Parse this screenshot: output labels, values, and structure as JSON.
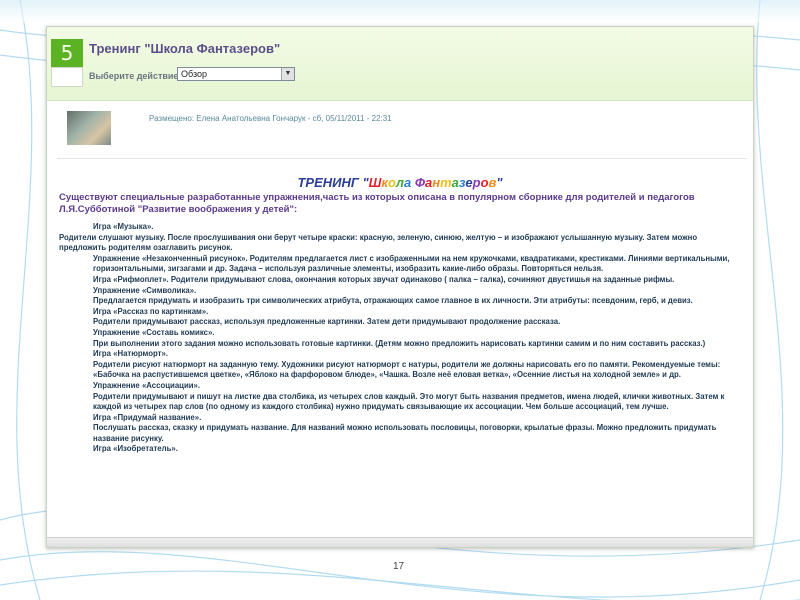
{
  "panel": {
    "badge": "5",
    "title": "Тренинг \"Школа Фантазеров\"",
    "action_label": "Выберите действие:",
    "action_value": "Обзор",
    "posted": "Размещено: Елена Анатольевна Гончарук - сб, 05/11/2011 - 22:31"
  },
  "doc": {
    "title_prefix": "ТРЕНИНГ  \"",
    "title_letters": [
      "Ш",
      "к",
      "о",
      "л",
      "а",
      " ",
      "Ф",
      "а",
      "н",
      "т",
      "а",
      "з",
      "е",
      "р",
      "о",
      "в"
    ],
    "title_suffix": "\"",
    "intro": "Существуют специальные разработанные упражнения,часть из которых описана в популярном сборнике для родителей и педагогов Л.Я.Субботиной \"Развитие воображения у детей\":",
    "lines": [
      {
        "t": "Игра «Музыка».",
        "ind": true
      },
      {
        "t": "Родители слушают музыку. После прослушивания они берут четыре краски: красную, зеленую, синюю, желтую – и изображают услышанную музыку. Затем можно предложить родителям озаглавить рисунок.",
        "ind": false
      },
      {
        "t": "Упражнение «Незаконченный рисунок». Родителям предлагается лист с изображенными на нем кружочками, квадратиками, крестиками. Линиями вертикальными, горизонтальными, зигзагами и др. Задача – используя различные элементы, изобразить какие-либо образы. Повторяться нельзя.",
        "ind": true
      },
      {
        "t": "Игра «Рифмоплет». Родители придумывают слова, окончания которых звучат одинаково ( палка – галка), сочиняют двустишья на  заданные рифмы.",
        "ind": true
      },
      {
        "t": "Упражнение «Символика».",
        "ind": true
      },
      {
        "t": "Предлагается  придумать и изобразить три символических атрибута, отражающих самое главное в их личности. Эти атрибуты: псевдоним, герб, и девиз.",
        "ind": true
      },
      {
        "t": "Игра «Рассказ по картинкам».",
        "ind": true
      },
      {
        "t": "Родители придумывают рассказ, используя предложенные картинки. Затем дети придумывают продолжение рассказа.",
        "ind": true
      },
      {
        "t": "Упражнение «Составь комикс».",
        "ind": true
      },
      {
        "t": "При выполнении этого задания можно использовать готовые  картинки. (Детям можно предложить нарисовать картинки   самим и по ним составить рассказ.)",
        "ind": true
      },
      {
        "t": "Игра «Натюрморт».",
        "ind": true
      },
      {
        "t": "Родители рисуют натюрморт на заданную тему. Художники рисуют натюрморт с натуры, родители же должны нарисовать его по памяти. Рекомендуемые  темы: «Бабочка на распустившемся цветке», «Яблоко на фарфоровом блюде», «Чашка. Возле неё еловая ветка», «Осенние листья на холодной земле» и др.",
        "ind": true
      },
      {
        "t": "Упражнение «Ассоциации».",
        "ind": true
      },
      {
        "t": "Родители придумывают и пишут на листке два столбика, из четырех слов каждый. Это могут быть названия предметов, имена людей, клички животных. Затем к каждой из четырех пар слов (по одному из каждого столбика) нужно придумать связывающие их ассоциации. Чем больше ассоциаций, тем лучше.",
        "ind": true
      },
      {
        "t": "Игра «Придумай название».",
        "ind": true
      },
      {
        "t": "Послушать рассказ, сказку и придумать название. Для названий можно использовать пословицы, поговорки, крылатые фразы. Можно предложить придумать название рисунку.",
        "ind": true
      },
      {
        "t": "Игра «Изобретатель».",
        "ind": true
      }
    ]
  },
  "page_number": "17",
  "colors": {
    "rainbow": [
      "#e0202a",
      "#f08a1c",
      "#e8c21a",
      "#3aa83a",
      "#2a7fd0",
      "#2a3f94",
      "#8a3ab0",
      "#e0202a",
      "#f08a1c",
      "#e8c21a",
      "#3aa83a",
      "#2a7fd0",
      "#2a3f94",
      "#8a3ab0",
      "#e0202a",
      "#f08a1c"
    ],
    "badge": "#5bb324",
    "title": "#5b4f8a"
  }
}
